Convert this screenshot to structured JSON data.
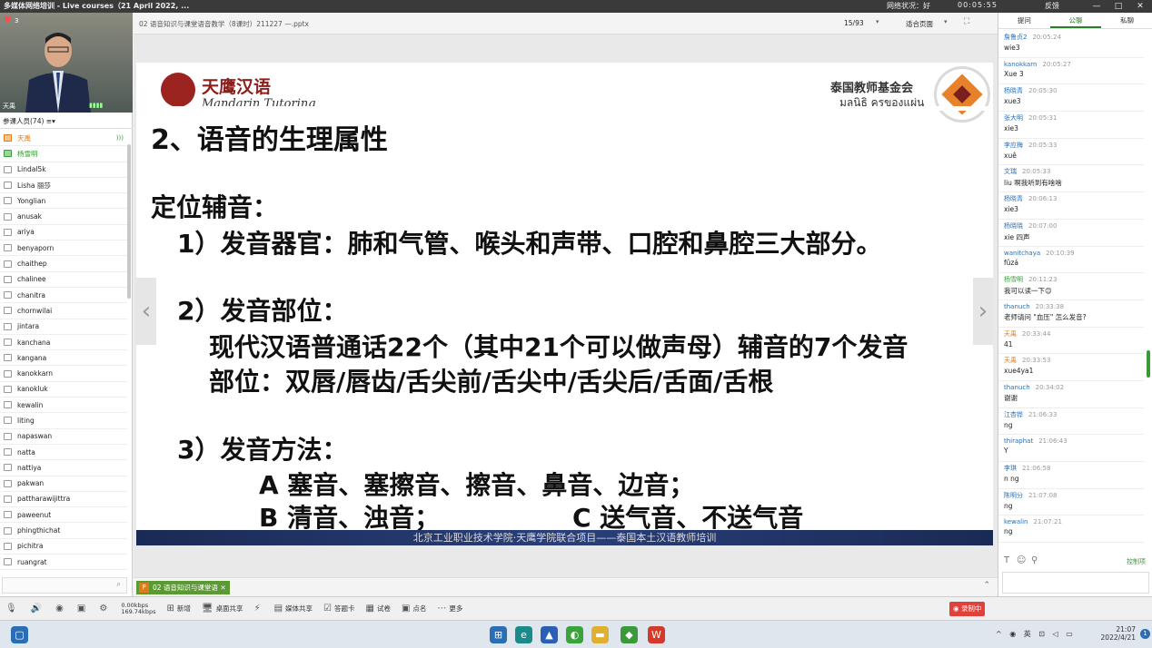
{
  "window": {
    "title": "多媒体网络培训 - Live courses（21 April 2022, ...",
    "net_status": "网络状况：好",
    "timer": "00:05:55",
    "feedback": "反馈",
    "min": "—",
    "max": "□",
    "close": "✕"
  },
  "video": {
    "viewer_count": "3",
    "presenter_name": "天禹",
    "signal": "▮▮▮▮"
  },
  "participants": {
    "header": "参课人员(74)",
    "items": [
      {
        "name": "天禹",
        "state": "active"
      },
      {
        "name": "杨雪明",
        "state": "green"
      },
      {
        "name": "Lindal5k",
        "state": ""
      },
      {
        "name": "Lisha 丽莎",
        "state": ""
      },
      {
        "name": "Yonglian",
        "state": ""
      },
      {
        "name": "anusak",
        "state": ""
      },
      {
        "name": "ariya",
        "state": ""
      },
      {
        "name": "benyaporn",
        "state": ""
      },
      {
        "name": "chaithep",
        "state": ""
      },
      {
        "name": "chalinee",
        "state": ""
      },
      {
        "name": "chanitra",
        "state": ""
      },
      {
        "name": "chornwilai",
        "state": ""
      },
      {
        "name": "jintara",
        "state": ""
      },
      {
        "name": "kanchana",
        "state": ""
      },
      {
        "name": "kangana",
        "state": ""
      },
      {
        "name": "kanokkarn",
        "state": ""
      },
      {
        "name": "kanokluk",
        "state": ""
      },
      {
        "name": "kewalin",
        "state": ""
      },
      {
        "name": "liting",
        "state": ""
      },
      {
        "name": "napaswan",
        "state": ""
      },
      {
        "name": "natta",
        "state": ""
      },
      {
        "name": "nattiya",
        "state": ""
      },
      {
        "name": "pakwan",
        "state": ""
      },
      {
        "name": "pattharawijittra",
        "state": ""
      },
      {
        "name": "paweenut",
        "state": ""
      },
      {
        "name": "phingthichat",
        "state": ""
      },
      {
        "name": "pichitra",
        "state": ""
      },
      {
        "name": "ruangrat",
        "state": ""
      }
    ]
  },
  "doc": {
    "filename": "02 语音知识与课堂语音教学（8课时）211227 —.pptx",
    "page": "15/93",
    "fit": "适合页面",
    "tab_label": "02 语音知识与课堂语"
  },
  "slide": {
    "brand": "天鹰汉语",
    "brand_sub": "Mandarin Tutoring",
    "foundation": "泰国教师基金会",
    "foundation_thai": "มลนิธิ ครูของแผ่น",
    "heading": "2、语音的生理属性",
    "l1": "定位辅音：",
    "l2": "1）发音器官：肺和气管、喉头和声带、口腔和鼻腔三大部分。",
    "l3": "2）发音部位：",
    "l4": "现代汉语普通话22个（其中21个可以做声母）辅音的7个发音",
    "l5": "部位：双唇/唇齿/舌尖前/舌尖中/舌尖后/舌面/舌根",
    "l6": "3）发音方法：",
    "l7": "A 塞音、塞擦音、擦音、鼻音、边音；",
    "l8a": "B 清音、浊音；",
    "l8b": "C 送气音、不送气音",
    "footer": "北京工业职业技术学院·天鹰学院联合项目——泰国本土汉语教师培训"
  },
  "chat": {
    "tabs": [
      "提问",
      "公聊",
      "私聊"
    ],
    "messages": [
      {
        "user": "詹鲁贞2",
        "time": "20:05:24",
        "text": "wie3",
        "color": "blue"
      },
      {
        "user": "kanokkarn",
        "time": "20:05:27",
        "text": "Xue 3",
        "color": "blue"
      },
      {
        "user": "杨晓青",
        "time": "20:05:30",
        "text": "xue3",
        "color": "blue"
      },
      {
        "user": "张大明",
        "time": "20:05:31",
        "text": "xie3",
        "color": "blue"
      },
      {
        "user": "李应梅",
        "time": "20:05:33",
        "text": "xuê",
        "color": "blue"
      },
      {
        "user": "文瑞",
        "time": "20:05:33",
        "text": "liu 啊我听到有啥啥",
        "color": "blue"
      },
      {
        "user": "杨晓青",
        "time": "20:06:13",
        "text": "xie3",
        "color": "blue"
      },
      {
        "user": "杨晓晓",
        "time": "20:07:00",
        "text": "xie 四声",
        "color": "blue"
      },
      {
        "user": "wanitchaya",
        "time": "20:10:39",
        "text": "fǔzá",
        "color": "blue"
      },
      {
        "user": "杨雪明",
        "time": "20:11:23",
        "text": "我可以读一下😊",
        "color": "grn"
      },
      {
        "user": "thanuch",
        "time": "20:33:38",
        "text": "老师请问 \"血压\" 怎么发音?",
        "color": "blue"
      },
      {
        "user": "天禹",
        "time": "20:33:44",
        "text": "41",
        "color": "org"
      },
      {
        "user": "天禹",
        "time": "20:33:53",
        "text": "xue4ya1",
        "color": "org"
      },
      {
        "user": "thanuch",
        "time": "20:34:02",
        "text": "谢谢",
        "color": "blue"
      },
      {
        "user": "江杏铧",
        "time": "21:06:33",
        "text": "ng",
        "color": "blue"
      },
      {
        "user": "thiraphat",
        "time": "21:06:43",
        "text": "Y",
        "color": "blue"
      },
      {
        "user": "李琪",
        "time": "21:06:58",
        "text": "n ng",
        "color": "blue"
      },
      {
        "user": "陈明分",
        "time": "21:07:08",
        "text": "ng",
        "color": "blue"
      },
      {
        "user": "kewalin",
        "time": "21:07:21",
        "text": "ng",
        "color": "blue"
      }
    ],
    "rules": "控制项"
  },
  "toolbar": {
    "upload": "0.00kbps",
    "download": "169.74kbps",
    "new": "新增",
    "desktop_share": "桌面共享",
    "media_share": "媒体共享",
    "answer_card": "答题卡",
    "quiz": "试卷",
    "rollcall": "点名",
    "more": "更多",
    "record": "录制中"
  },
  "taskbar": {
    "tray": "^ ◉ 英 ⊡ ◁ ▭",
    "time": "21:07",
    "date": "2022/4/21",
    "notif": "1"
  }
}
